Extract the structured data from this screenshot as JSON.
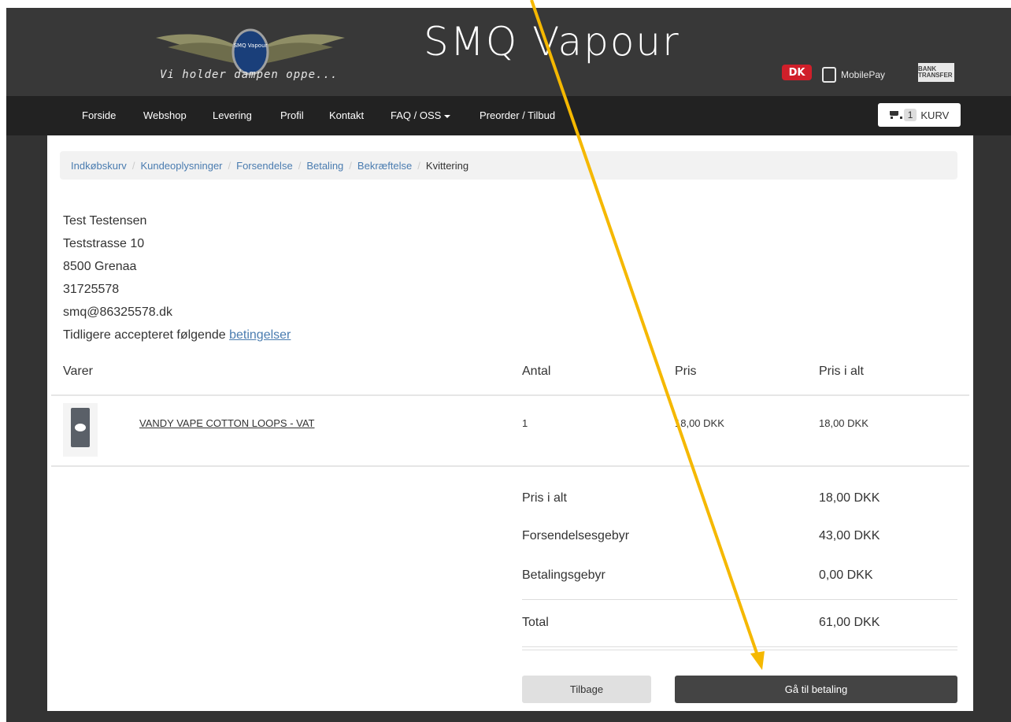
{
  "header": {
    "tagline": "Vi holder dampen oppe...",
    "brand": "SMQ Vapour",
    "logo_text": "SMQ Vapour",
    "payments": {
      "dk": "DK",
      "mobilepay": "MobilePay",
      "bank": "BANK TRANSFER"
    }
  },
  "nav": {
    "items": [
      "Forside",
      "Webshop",
      "Levering",
      "Profil",
      "Kontakt",
      "FAQ / OSS",
      "Preorder / Tilbud"
    ],
    "cart_count": "1",
    "cart_label": "KURV"
  },
  "breadcrumb": [
    "Indkøbskurv",
    "Kundeoplysninger",
    "Forsendelse",
    "Betaling",
    "Bekræftelse",
    "Kvittering"
  ],
  "customer": {
    "name": "Test Testensen",
    "street": "Teststrasse 10",
    "city": "8500 Grenaa",
    "phone": "31725578",
    "email": "smq@86325578.dk",
    "terms_text": "Tidligere accepteret følgende",
    "terms_link": "betingelser"
  },
  "table": {
    "headers": [
      "Varer",
      "Antal",
      "Pris",
      "Pris i alt"
    ],
    "rows": [
      {
        "name": "VANDY VAPE COTTON LOOPS - VAT",
        "qty": "1",
        "price": "18,00 DKK",
        "total": "18,00 DKK"
      }
    ]
  },
  "summary": {
    "subtotal_label": "Pris i alt",
    "subtotal": "18,00 DKK",
    "shipping_label": "Forsendelsesgebyr",
    "shipping": "43,00 DKK",
    "payment_label": "Betalingsgebyr",
    "payment": "0,00 DKK",
    "total_label": "Total",
    "total": "61,00 DKK"
  },
  "buttons": {
    "back": "Tilbage",
    "pay": "Gå til betaling"
  },
  "colors": {
    "accent": "#f5b800",
    "link": "#4a7cb0",
    "dark": "#333333",
    "dk_red": "#d01f2a"
  }
}
